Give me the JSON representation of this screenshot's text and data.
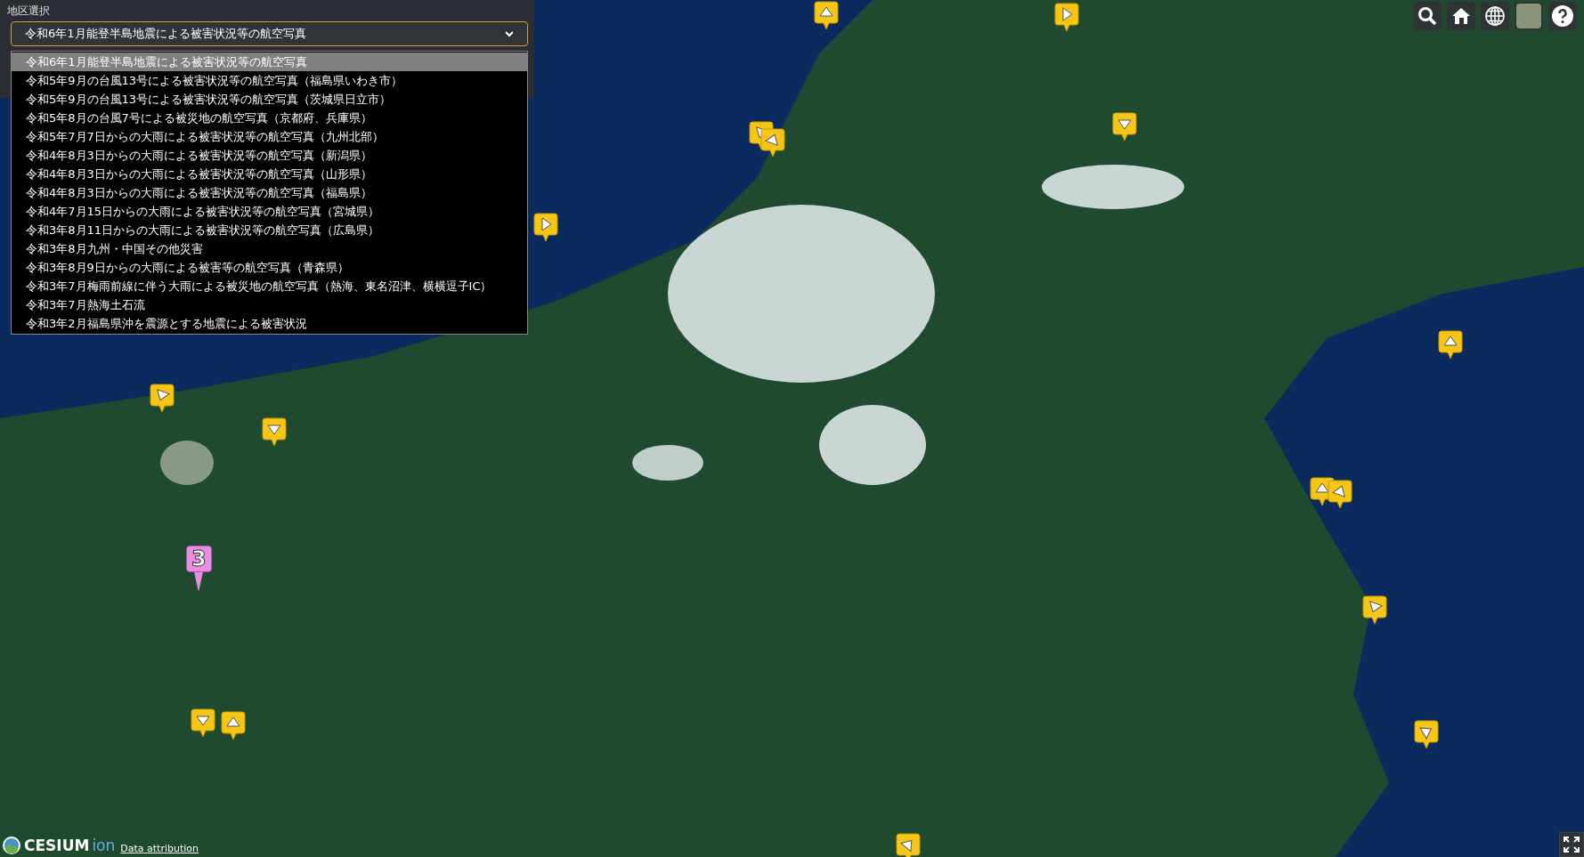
{
  "region_panel": {
    "label": "地区選択",
    "select": {
      "value": "令和6年1月能登半島地震による被害状況等の航空写真"
    },
    "options": [
      {
        "label": "令和6年1月能登半島地震による被害状況等の航空写真",
        "selected": true
      },
      {
        "label": "令和5年9月の台風13号による被害状況等の航空写真（福島県いわき市）",
        "selected": false
      },
      {
        "label": "令和5年9月の台風13号による被害状況等の航空写真（茨城県日立市）",
        "selected": false
      },
      {
        "label": "令和5年8月の台風7号による被災地の航空写真（京都府、兵庫県）",
        "selected": false
      },
      {
        "label": "令和5年7月7日からの大雨による被害状況等の航空写真（九州北部）",
        "selected": false
      },
      {
        "label": "令和4年8月3日からの大雨による被害状況等の航空写真（新潟県）",
        "selected": false
      },
      {
        "label": "令和4年8月3日からの大雨による被害状況等の航空写真（山形県）",
        "selected": false
      },
      {
        "label": "令和4年8月3日からの大雨による被害状況等の航空写真（福島県）",
        "selected": false
      },
      {
        "label": "令和4年7月15日からの大雨による被害状況等の航空写真（宮城県）",
        "selected": false
      },
      {
        "label": "令和3年8月11日からの大雨による被害状況等の航空写真（広島県）",
        "selected": false
      },
      {
        "label": "令和3年8月九州・中国その他災害",
        "selected": false
      },
      {
        "label": "令和3年8月9日からの大雨による被害等の航空写真（青森県）",
        "selected": false
      },
      {
        "label": "令和3年7月梅雨前線に伴う大雨による被災地の航空写真（熱海、東名沼津、横横逗子IC）",
        "selected": false
      },
      {
        "label": "令和3年7月熱海土石流",
        "selected": false
      },
      {
        "label": "令和3年2月福島県沖を震源とする地震による被害状況",
        "selected": false
      }
    ]
  },
  "map": {
    "cluster_label": "3"
  },
  "footer": {
    "logo_text": "CESIUM",
    "logo_suffix": "ion",
    "attribution_link": "Data attribution"
  }
}
